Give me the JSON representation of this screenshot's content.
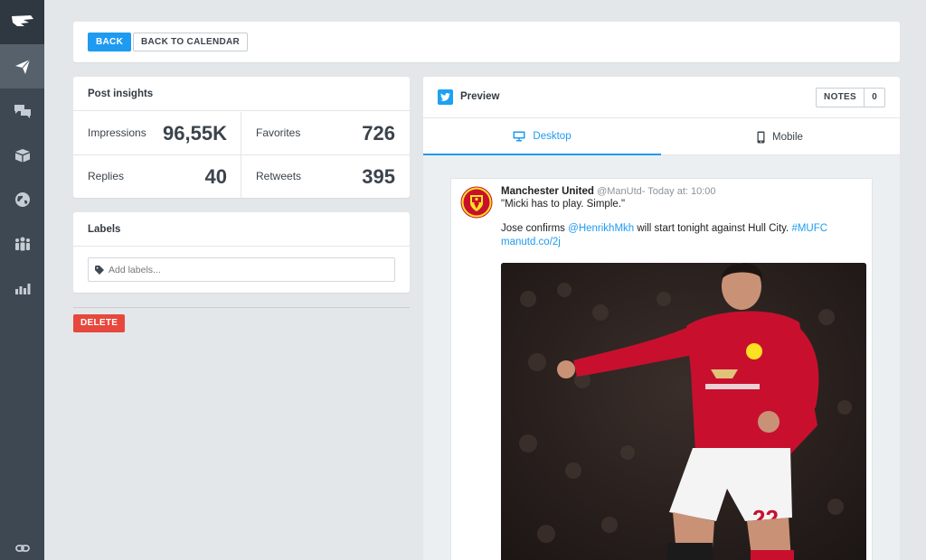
{
  "sidebar": {
    "items": [
      {
        "icon": "brand-logo-icon"
      },
      {
        "icon": "paper-plane-icon"
      },
      {
        "icon": "chat-bubbles-icon"
      },
      {
        "icon": "box-icon"
      },
      {
        "icon": "globe-icon"
      },
      {
        "icon": "people-icon"
      },
      {
        "icon": "bar-chart-icon"
      }
    ],
    "bottom_icon": "link-icon"
  },
  "toolbar": {
    "back_label": "BACK",
    "back_calendar_label": "BACK TO CALENDAR"
  },
  "insights": {
    "title": "Post insights",
    "impressions_label": "Impressions",
    "impressions_value": "96,55K",
    "favorites_label": "Favorites",
    "favorites_value": "726",
    "replies_label": "Replies",
    "replies_value": "40",
    "retweets_label": "Retweets",
    "retweets_value": "395"
  },
  "labels": {
    "title": "Labels",
    "placeholder": "Add labels..."
  },
  "delete_label": "DELETE",
  "preview": {
    "title": "Preview",
    "notes_label": "NOTES",
    "notes_count": "0",
    "tabs": {
      "desktop": "Desktop",
      "mobile": "Mobile"
    },
    "tweet": {
      "name": "Manchester United",
      "handle": "@ManUtd",
      "time": "- Today at: 10:00",
      "line1": "\"Micki has to play. Simple.\"",
      "text_start": "Jose confirms ",
      "mention": "@HenrikhMkh",
      "text_mid": " will start tonight against Hull City. ",
      "hashtag": "#MUFC",
      "url": " manutd.co/2j"
    }
  },
  "colors": {
    "accent": "#1e9bf0",
    "danger": "#e6483d",
    "sidebar": "#3e4853",
    "club_red": "#c8102e"
  }
}
